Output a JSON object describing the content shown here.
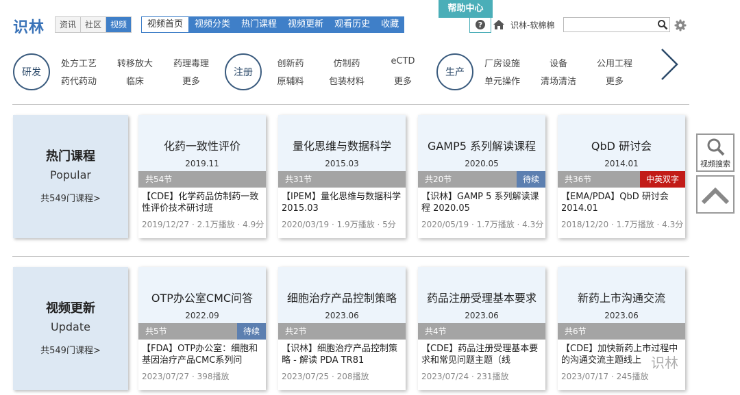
{
  "header": {
    "logo": "识林",
    "help_tab": "帮助中心",
    "segments": [
      "资讯",
      "社区",
      "视频"
    ],
    "nav": [
      "视频首页",
      "视频分类",
      "热门课程",
      "视频更新",
      "观看历史",
      "收藏"
    ],
    "user": "识林-软棉棉",
    "search_value": ""
  },
  "categories": {
    "groups": [
      {
        "name": "研发",
        "items": [
          "处方工艺",
          "转移放大",
          "药理毒理",
          "药代药动",
          "临床",
          "更多"
        ]
      },
      {
        "name": "注册",
        "items": [
          "创新药",
          "仿制药",
          "eCTD",
          "原辅料",
          "包装材料",
          "更多"
        ]
      },
      {
        "name": "生产",
        "items": [
          "厂房设施",
          "设备",
          "公用工程",
          "单元操作",
          "清场清洁",
          "更多"
        ]
      }
    ]
  },
  "rows": [
    {
      "title": "热门课程",
      "title_en": "Popular",
      "count": "共549门课程>",
      "cards": [
        {
          "title": "化药一致性评价",
          "date": "2019.11",
          "count": "共54节",
          "tag": "",
          "desc": "【CDE】化学药品仿制药一致性评价技术研讨班",
          "meta": "2019/12/27 · 2.1万播放 · 4.9分"
        },
        {
          "title": "量化思维与数据科学",
          "date": "2015.03",
          "count": "共31节",
          "tag": "",
          "desc": "【IPEM】量化思维与数据科学 2015.03",
          "meta": "2020/03/19 · 1.9万播放 · 5分"
        },
        {
          "title": "GAMP5 系列解读课程",
          "date": "2020.05",
          "count": "共20节",
          "tag": "待续",
          "tag_color": "blue",
          "desc": "【识林】GAMP 5 系列解读课程 2020.05",
          "meta": "2020/05/19 · 1.7万播放 · 4.3分"
        },
        {
          "title": "QbD 研讨会",
          "date": "2014.01",
          "count": "共36节",
          "tag": "中英双字",
          "tag_color": "red",
          "desc": "【EMA/PDA】QbD 研讨会 2014.01",
          "meta": "2018/12/20 · 1.7万播放 · 4.3分"
        }
      ]
    },
    {
      "title": "视频更新",
      "title_en": "Update",
      "count": "共549门课程>",
      "cards": [
        {
          "title": "OTP办公室CMC问答",
          "date": "2022.09",
          "count": "共5节",
          "tag": "待续",
          "tag_color": "blue",
          "desc": "【FDA】OTP办公室：细胞和基因治疗产品CMC系列问",
          "meta": "2023/07/27 · 398播放"
        },
        {
          "title": "细胞治疗产品控制策略",
          "date": "2023.06",
          "count": "共2节",
          "tag": "",
          "desc": "【识林】细胞治疗产品控制策略 - 解读 PDA TR81",
          "meta": "2023/07/25 · 208播放"
        },
        {
          "title": "药品注册受理基本要求",
          "date": "2023.06",
          "count": "共4节",
          "tag": "",
          "desc": "【CDE】药品注册受理基本要求和常见问题主题（线",
          "meta": "2023/07/24 · 231播放"
        },
        {
          "title": "新药上市沟通交流",
          "date": "2023.06",
          "count": "共6节",
          "tag": "",
          "desc": "【CDE】加快新药上市过程中的沟通交流主题线上",
          "meta": "2023/07/17 · 245播放"
        }
      ]
    }
  ],
  "side": {
    "search_label": "视频搜索"
  },
  "watermark": "识林",
  "icons": [
    "question-icon",
    "home-icon",
    "search-icon",
    "gear-icon",
    "chevron-right-icon",
    "magnifier-icon",
    "chevron-up-icon"
  ]
}
